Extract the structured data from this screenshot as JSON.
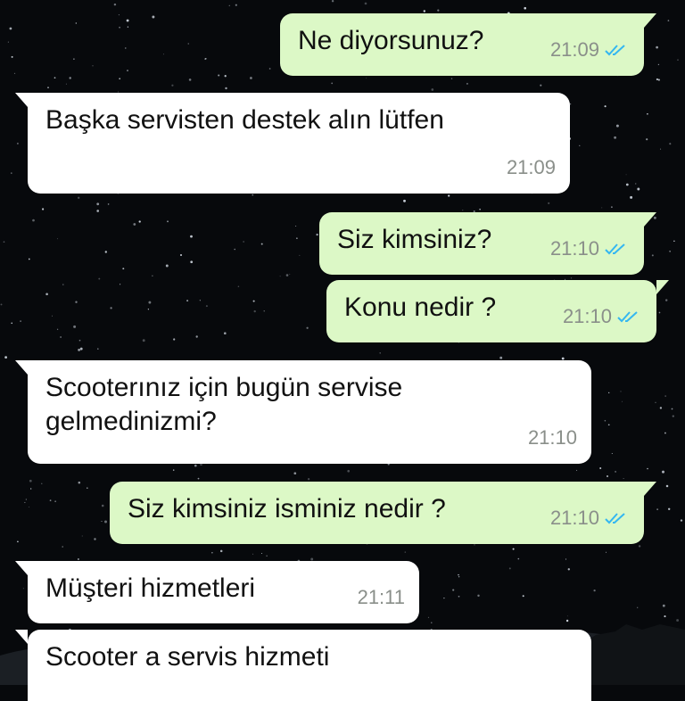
{
  "messages": [
    {
      "direction": "out",
      "text": "Ne diyorsunuz?",
      "time": "21:09",
      "read": true
    },
    {
      "direction": "in",
      "text": "Başka servisten destek alın lütfen",
      "time": "21:09"
    },
    {
      "direction": "out",
      "text": "Siz kimsiniz?",
      "time": "21:10",
      "read": true
    },
    {
      "direction": "out",
      "text": "Konu nedir ?",
      "time": "21:10",
      "read": true
    },
    {
      "direction": "in",
      "text": "Scooterınız için bugün servise\ngelmedinizmi?",
      "time": "21:10"
    },
    {
      "direction": "out",
      "text": "Siz kimsiniz isminiz nedir ?",
      "time": "21:10",
      "read": true
    },
    {
      "direction": "in",
      "text": "Müşteri hizmetleri",
      "time": "21:11"
    },
    {
      "direction": "in",
      "text": "Scooter a servis hizmeti",
      "time": ""
    }
  ],
  "colors": {
    "outgoing_bubble": "#dcf8c6",
    "incoming_bubble": "#ffffff",
    "read_ticks": "#34b7f1",
    "timestamp": "#8a8f8a"
  },
  "icons": {
    "read_receipt": "double-check-icon"
  }
}
